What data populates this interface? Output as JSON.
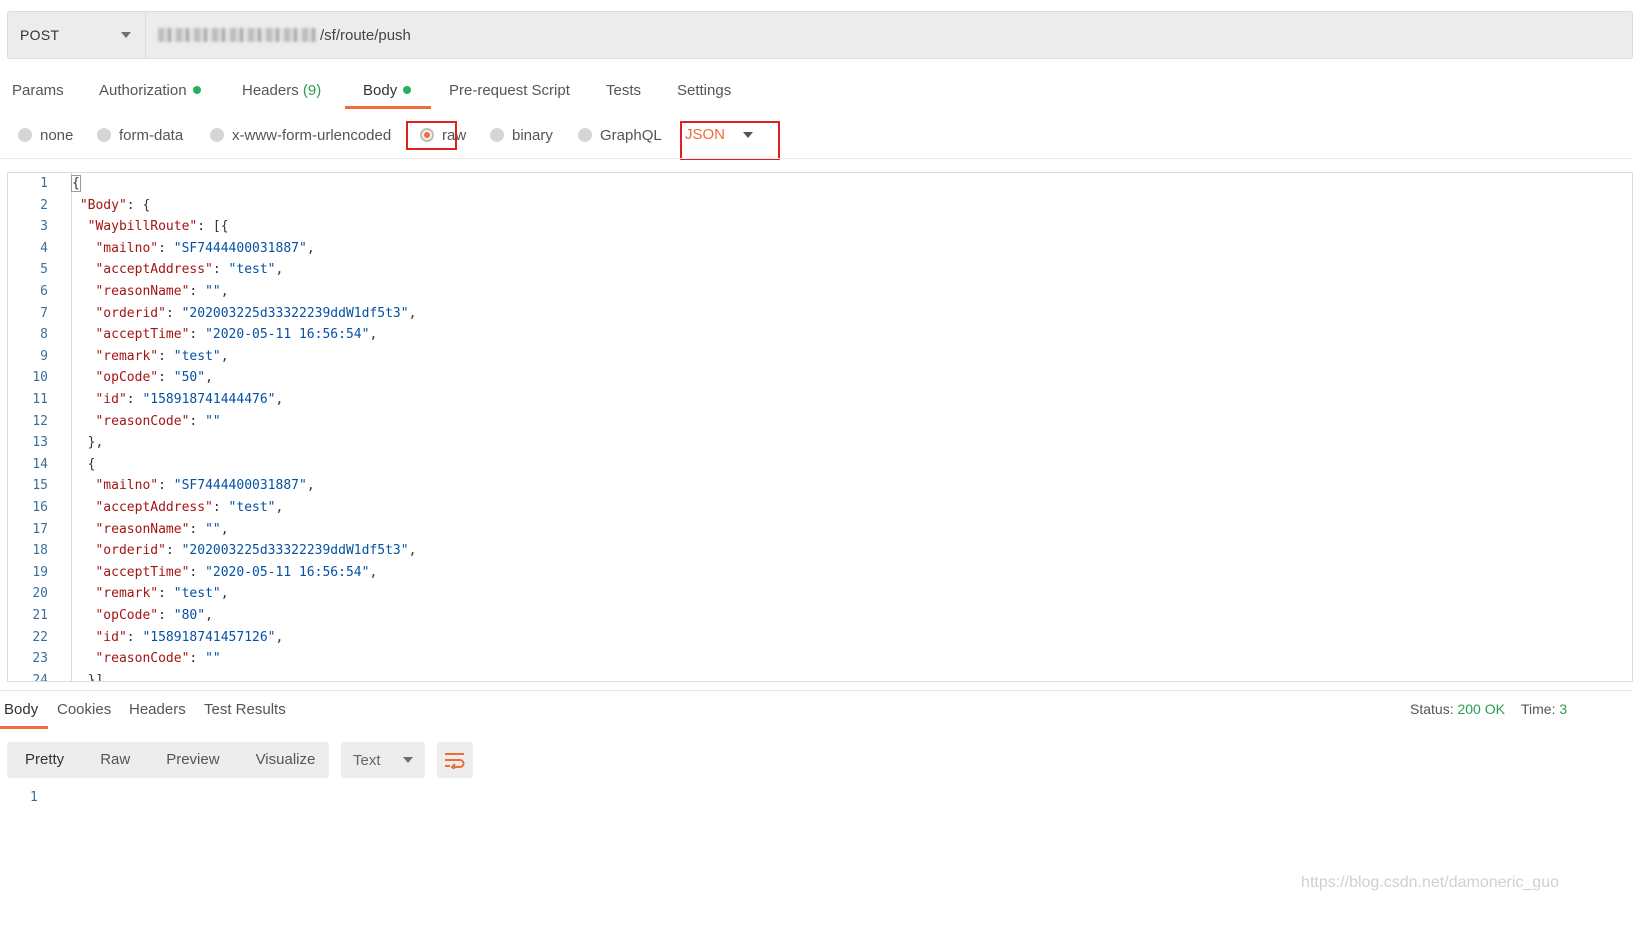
{
  "request": {
    "method": "POST",
    "url_visible": "/sf/route/push"
  },
  "request_tabs": [
    {
      "label": "Params"
    },
    {
      "label": "Authorization",
      "has_dot": true
    },
    {
      "label": "Headers",
      "count": "(9)"
    },
    {
      "label": "Body",
      "has_dot": true,
      "active": true
    },
    {
      "label": "Pre-request Script"
    },
    {
      "label": "Tests"
    },
    {
      "label": "Settings"
    }
  ],
  "body_types": {
    "options": [
      "none",
      "form-data",
      "x-www-form-urlencoded",
      "raw",
      "binary",
      "GraphQL"
    ],
    "selected": "raw",
    "format": "JSON"
  },
  "editor": {
    "lines": [
      {
        "n": "1",
        "text": "{"
      },
      {
        "n": "2",
        "text": " \"Body\": {"
      },
      {
        "n": "3",
        "text": "  \"WaybillRoute\": [{"
      },
      {
        "n": "4",
        "text": "   \"mailno\": \"SF7444400031887\","
      },
      {
        "n": "5",
        "text": "   \"acceptAddress\": \"test\","
      },
      {
        "n": "6",
        "text": "   \"reasonName\": \"\","
      },
      {
        "n": "7",
        "text": "   \"orderid\": \"202003225d33322239ddW1df5t3\","
      },
      {
        "n": "8",
        "text": "   \"acceptTime\": \"2020-05-11 16:56:54\","
      },
      {
        "n": "9",
        "text": "   \"remark\": \"test\","
      },
      {
        "n": "10",
        "text": "   \"opCode\": \"50\","
      },
      {
        "n": "11",
        "text": "   \"id\": \"158918741444476\","
      },
      {
        "n": "12",
        "text": "   \"reasonCode\": \"\""
      },
      {
        "n": "13",
        "text": "  },"
      },
      {
        "n": "14",
        "text": "  {"
      },
      {
        "n": "15",
        "text": "   \"mailno\": \"SF7444400031887\","
      },
      {
        "n": "16",
        "text": "   \"acceptAddress\": \"test\","
      },
      {
        "n": "17",
        "text": "   \"reasonName\": \"\","
      },
      {
        "n": "18",
        "text": "   \"orderid\": \"202003225d33322239ddW1df5t3\","
      },
      {
        "n": "19",
        "text": "   \"acceptTime\": \"2020-05-11 16:56:54\","
      },
      {
        "n": "20",
        "text": "   \"remark\": \"test\","
      },
      {
        "n": "21",
        "text": "   \"opCode\": \"80\","
      },
      {
        "n": "22",
        "text": "   \"id\": \"158918741457126\","
      },
      {
        "n": "23",
        "text": "   \"reasonCode\": \"\""
      },
      {
        "n": "24",
        "text": "  }]"
      }
    ]
  },
  "response": {
    "tabs": [
      "Body",
      "Cookies",
      "Headers",
      "Test Results"
    ],
    "active_tab": "Body",
    "status_label": "Status:",
    "status_value": "200 OK",
    "time_label": "Time:",
    "time_value": "3",
    "view_modes": [
      "Pretty",
      "Raw",
      "Preview",
      "Visualize"
    ],
    "active_view": "Pretty",
    "format": "Text",
    "wrap_icon": "wrap-lines-icon",
    "lines": [
      "1"
    ]
  },
  "watermark": "https://blog.csdn.net/damoneric_guo",
  "colors": {
    "accent": "#f26b3a",
    "success": "#2a9d4f",
    "json_key": "#a31515",
    "json_string": "#0451a5",
    "highlight_box": "#e02020"
  }
}
